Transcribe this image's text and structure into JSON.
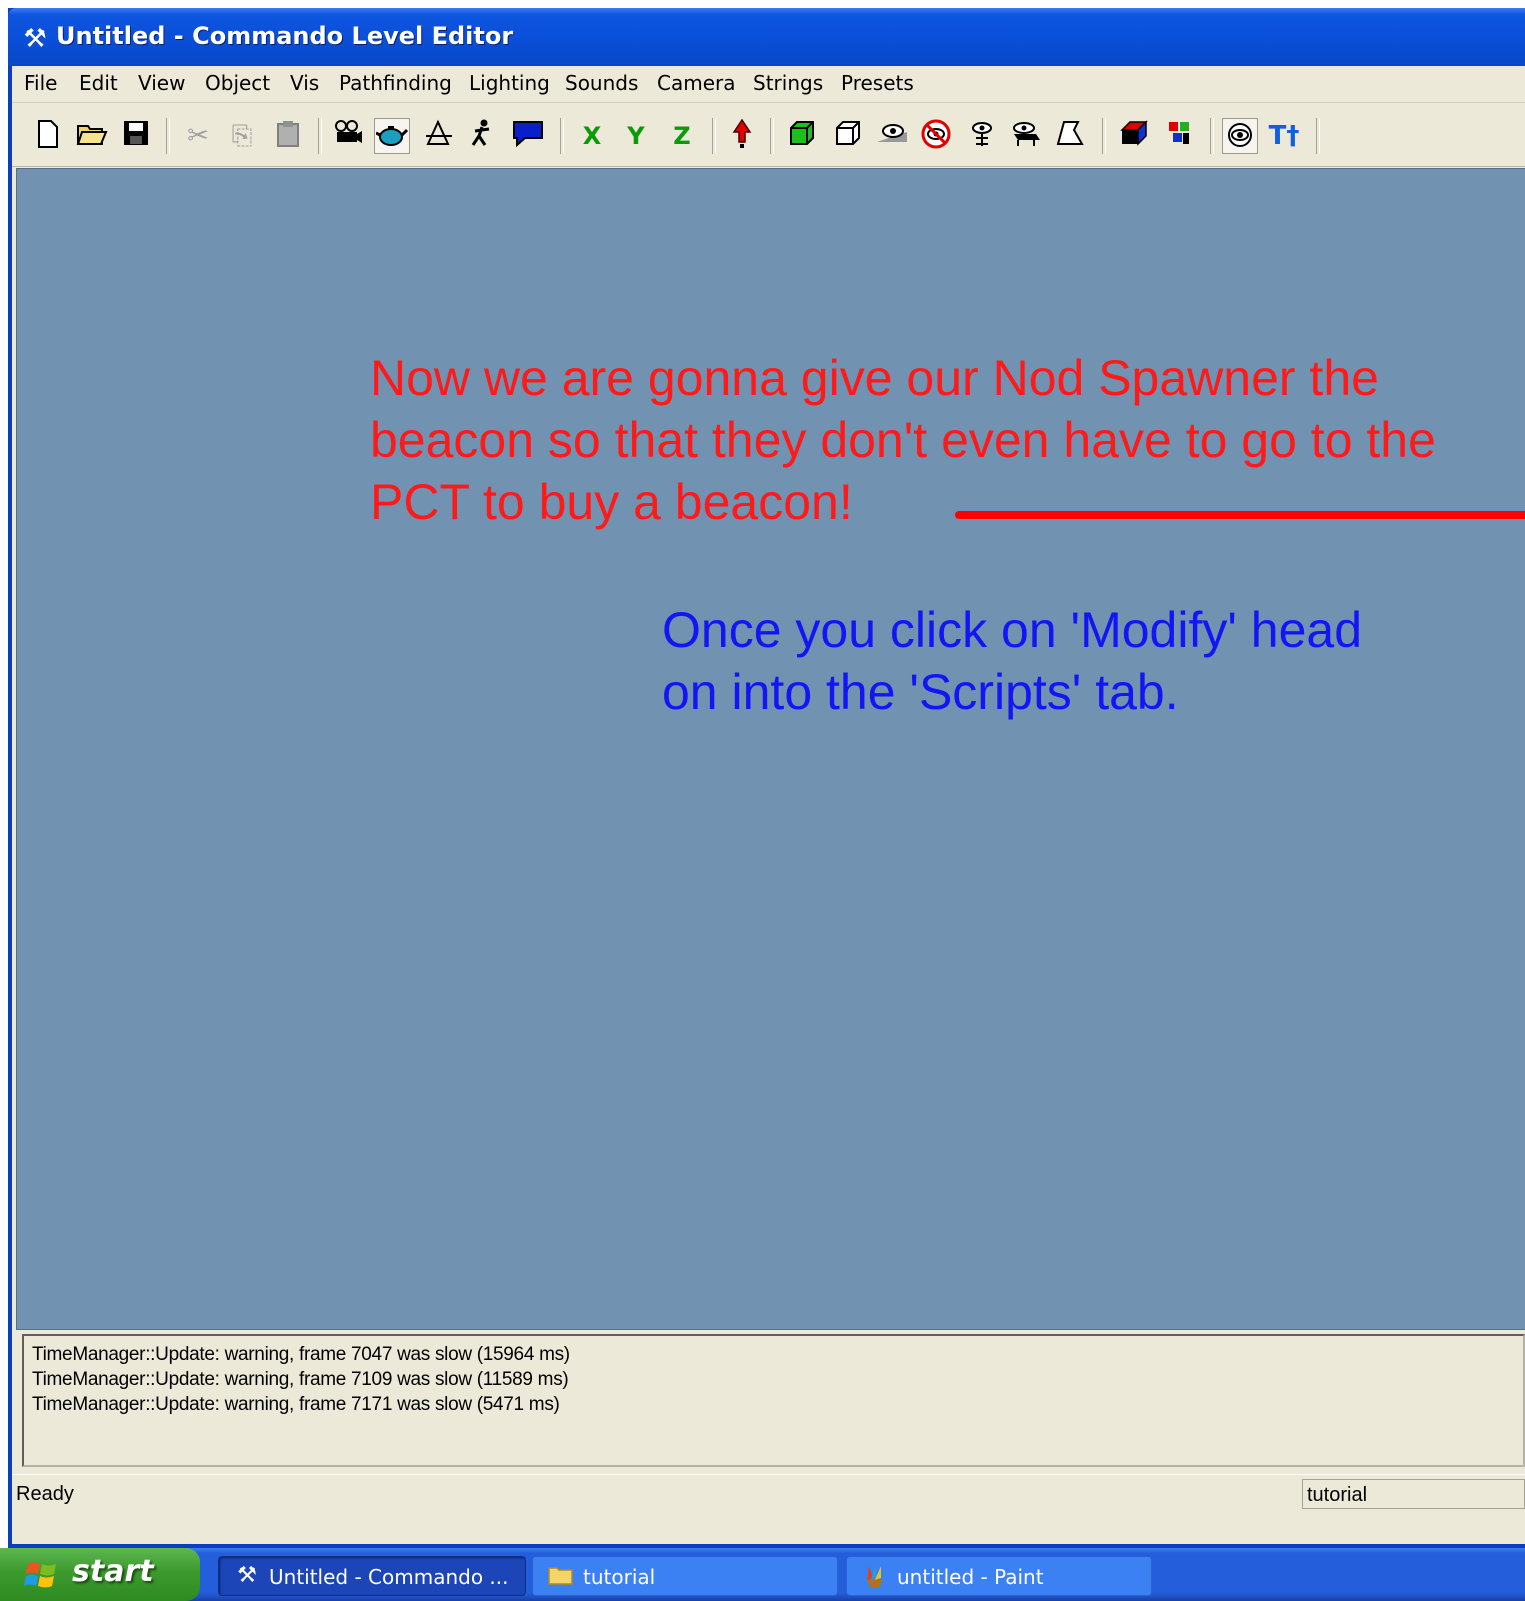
{
  "window": {
    "title": "Untitled - Commando Level Editor"
  },
  "menu": [
    "File",
    "Edit",
    "View",
    "Object",
    "Vis",
    "Pathfinding",
    "Lighting",
    "Sounds",
    "Camera",
    "Strings",
    "Presets"
  ],
  "toolbar": {
    "axis_x": "X",
    "axis_y": "Y",
    "axis_z": "Z",
    "text_tool": "T†"
  },
  "viewport": {
    "background": "#7192b0",
    "annotation_red": [
      "Now we are gonna give our Nod Spawner the",
      "beacon so that they don't even have to go to the",
      "PCT to buy a beacon!"
    ],
    "annotation_blue": [
      "Once you click on 'Modify' head",
      "on into the 'Scripts' tab."
    ]
  },
  "output": {
    "lines": [
      "TimeManager::Update: warning, frame 7047 was slow (15964 ms)",
      "TimeManager::Update: warning, frame 7109 was slow (11589 ms)",
      "TimeManager::Update: warning, frame 7171 was slow (5471 ms)"
    ]
  },
  "status": {
    "text": "Ready",
    "pane": "tutorial"
  },
  "taskbar": {
    "start": "start",
    "tasks": [
      {
        "label": "Untitled - Commando ...",
        "icon": "tools-icon"
      },
      {
        "label": "tutorial",
        "icon": "folder-icon"
      },
      {
        "label": "untitled - Paint",
        "icon": "paint-icon"
      }
    ]
  }
}
